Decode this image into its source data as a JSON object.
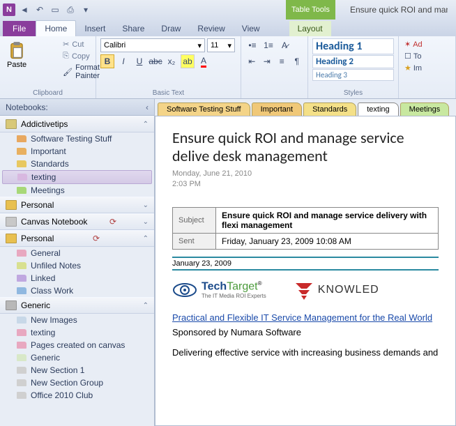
{
  "titlebar": {
    "app_letter": "N",
    "table_tools": "Table Tools",
    "window_title": "Ensure quick ROI and manage s"
  },
  "tabs": {
    "file": "File",
    "home": "Home",
    "insert": "Insert",
    "share": "Share",
    "draw": "Draw",
    "review": "Review",
    "view": "View",
    "layout": "Layout"
  },
  "ribbon": {
    "clipboard": {
      "label": "Clipboard",
      "paste": "Paste",
      "cut": "Cut",
      "copy": "Copy",
      "format_painter": "Format Painter"
    },
    "font": {
      "label": "Basic Text",
      "name": "Calibri",
      "size": "11"
    },
    "paragraph": {
      "label": ""
    },
    "styles": {
      "label": "Styles",
      "h1": "Heading 1",
      "h2": "Heading 2",
      "h3": "Heading 3"
    },
    "extra": {
      "add": "Ad",
      "to": "To",
      "imp": "Im"
    }
  },
  "nav": {
    "header": "Notebooks:",
    "notebooks": [
      {
        "name": "Addictivetips",
        "color": "#d8c878",
        "expanded": true,
        "sync": false,
        "sections": [
          {
            "name": "Software Testing Stuff",
            "color": "#e8a860"
          },
          {
            "name": "Important",
            "color": "#e8b060"
          },
          {
            "name": "Standards",
            "color": "#e8c860"
          },
          {
            "name": "texting",
            "color": "#d8b8e0",
            "selected": true
          },
          {
            "name": "Meetings",
            "color": "#a8d878"
          }
        ]
      },
      {
        "name": "Personal",
        "color": "#e8c050",
        "expanded": false,
        "sync": false
      },
      {
        "name": "Canvas Notebook",
        "color": "#c8c8c8",
        "expanded": false,
        "sync": true
      },
      {
        "name": "Personal",
        "color": "#e8c050",
        "expanded": true,
        "sync": true,
        "sections": [
          {
            "name": "General",
            "color": "#e8a8c0"
          },
          {
            "name": "Unfiled Notes",
            "color": "#d8e090"
          },
          {
            "name": "Linked",
            "color": "#c0a8e0"
          },
          {
            "name": "Class Work",
            "color": "#90b8e0"
          }
        ]
      },
      {
        "name": "Generic",
        "color": "#b8b8b8",
        "expanded": true,
        "sync": false,
        "sections": [
          {
            "name": "New Images",
            "color": "#c8d8e8"
          },
          {
            "name": "texting",
            "color": "#e8a8c0"
          },
          {
            "name": "Pages created on canvas",
            "color": "#e8a8c0"
          },
          {
            "name": "Generic",
            "color": "#d8e8c8"
          },
          {
            "name": "New Section 1",
            "color": "#d0d0d0"
          },
          {
            "name": "New Section Group",
            "color": "#d0d0d0"
          },
          {
            "name": "Office 2010 Club",
            "color": "#d0d0d0"
          }
        ]
      }
    ]
  },
  "section_tabs": [
    {
      "label": "Software Testing Stuff",
      "bg": "#f4d488"
    },
    {
      "label": "Important",
      "bg": "#f0c878"
    },
    {
      "label": "Standards",
      "bg": "#f4e088"
    },
    {
      "label": "texting",
      "bg": "#ffffff",
      "active": true
    },
    {
      "label": "Meetings",
      "bg": "#c8e8a0"
    }
  ],
  "page": {
    "title": "Ensure quick ROI and manage service delive desk management",
    "date": "Monday, June 21, 2010",
    "time": "2:03 PM",
    "email": {
      "subject_label": "Subject",
      "subject": "Ensure quick ROI and manage service delivery with flexi management",
      "sent_label": "Sent",
      "sent": "Friday, January 23, 2009 10:08 AM"
    },
    "email_date": "January 23, 2009",
    "techtarget_name": "TechTarget",
    "techtarget_tag": "The IT Media ROI Experts",
    "knowled": "KNOWLED",
    "link": "Practical and Flexible IT Service Management for the Real World",
    "sponsor": "Sponsored by Numara Software",
    "body": "Delivering effective service with increasing business demands and"
  }
}
